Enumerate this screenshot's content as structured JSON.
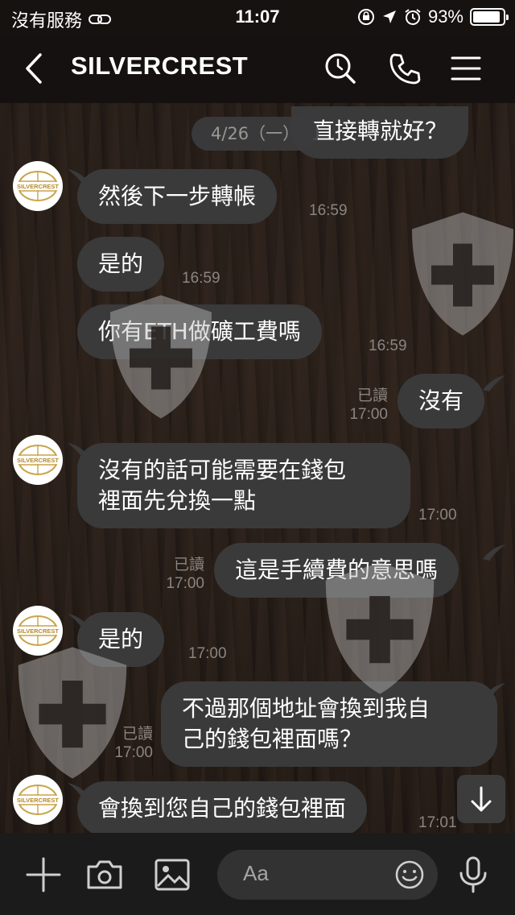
{
  "status": {
    "carrier": "沒有服務",
    "time": "11:07",
    "battery": "93%",
    "battery_level": 0.93
  },
  "header": {
    "title": "SILVERCREST"
  },
  "date_chip": "4/26（一）",
  "avatar_text": "SILVERCREST",
  "messages": [
    {
      "side": "right",
      "text": "直接轉就好？"
    },
    {
      "side": "left",
      "text": "然後下一步轉帳",
      "time": "16:59"
    },
    {
      "side": "left",
      "text": "是的",
      "time": "16:59"
    },
    {
      "side": "left",
      "text": "你有ETH做礦工費嗎",
      "time": "16:59"
    },
    {
      "side": "right",
      "text": "沒有",
      "read": "已讀",
      "time": "17:00"
    },
    {
      "side": "left",
      "lines": [
        "沒有的話可能需要在錢包",
        "裡面先兌換一點"
      ],
      "time": "17:00"
    },
    {
      "side": "right",
      "text": "這是手續費的意思嗎",
      "read": "已讀",
      "time": "17:00"
    },
    {
      "side": "left",
      "text": "是的",
      "time": "17:00"
    },
    {
      "side": "right",
      "lines": [
        "不過那個地址會換到我自",
        "己的錢包裡面嗎？"
      ],
      "read": "已讀",
      "time": "17:00"
    },
    {
      "side": "left",
      "text": "會換到您自己的錢包裡面",
      "time": "17:01"
    }
  ],
  "input": {
    "placeholder": "Aa"
  },
  "colors": {
    "bubble": "#3a3a3b",
    "background": "#1c1714",
    "meta_text": "#8a8580"
  }
}
